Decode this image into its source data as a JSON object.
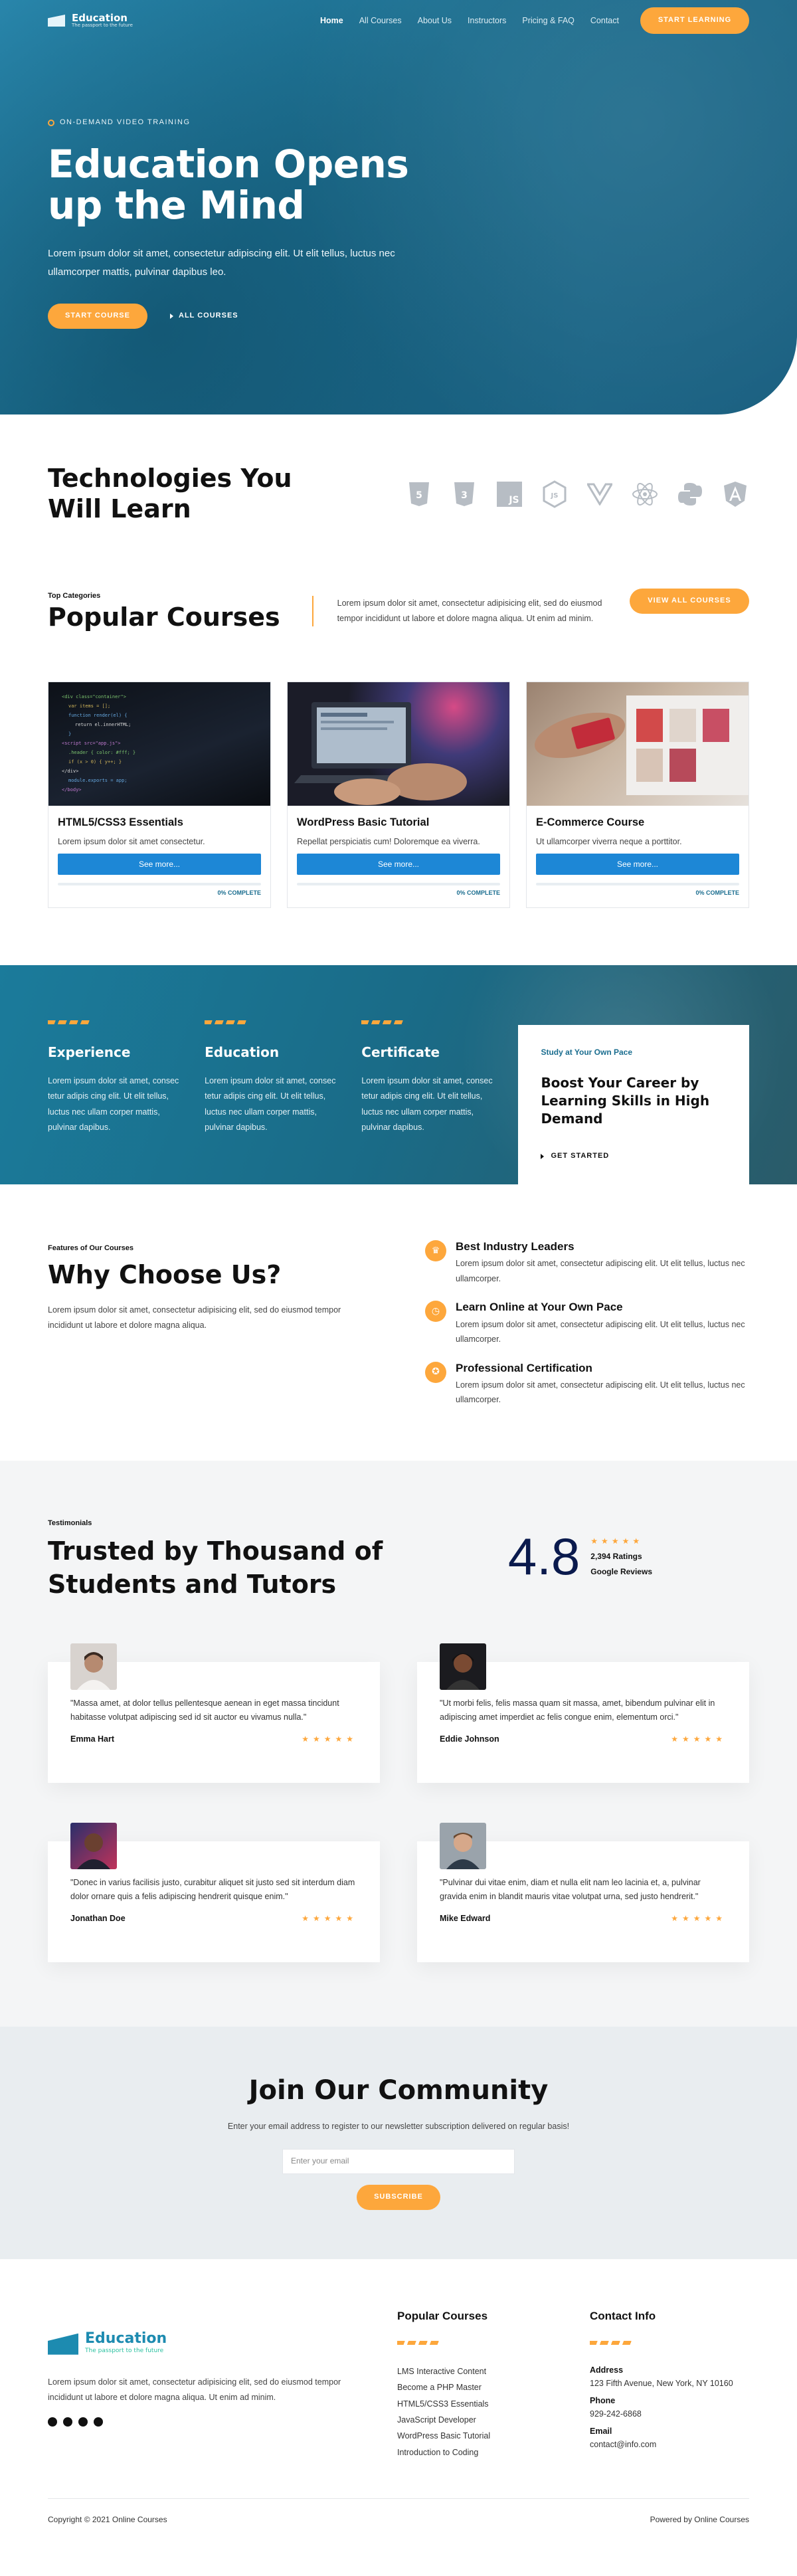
{
  "nav": {
    "logo_title": "Education",
    "logo_tagline": "The passport to the future",
    "items": [
      "Home",
      "All Courses",
      "About Us",
      "Instructors",
      "Pricing & FAQ",
      "Contact"
    ],
    "cta": "Start Learning"
  },
  "hero": {
    "eyebrow": "On-Demand Video Training",
    "title": "Education Opens up the Mind",
    "text": "Lorem ipsum dolor sit amet, consectetur adipiscing elit. Ut elit tellus, luctus nec ullamcorper mattis, pulvinar dapibus leo.",
    "cta_primary": "Start Course",
    "cta_secondary": "All Courses"
  },
  "tech": {
    "title": "Technologies You Will Learn",
    "icons": [
      "html5-icon",
      "css3-icon",
      "javascript-icon",
      "nodejs-icon",
      "vue-icon",
      "react-icon",
      "python-icon",
      "angular-icon"
    ]
  },
  "popular": {
    "eyebrow": "Top Categories",
    "title": "Popular Courses",
    "text": "Lorem ipsum dolor sit amet, consectetur adipisicing elit, sed do eiusmod tempor incididunt ut labore et dolore magna aliqua. Ut enim ad minim.",
    "cta": "View All Courses",
    "courses": [
      {
        "title": "HTML5/CSS3 Essentials",
        "text": "Lorem ipsum dolor sit amet consectetur.",
        "button": "See more...",
        "progress": "0% COMPLETE"
      },
      {
        "title": "WordPress Basic Tutorial",
        "text": "Repellat perspiciatis cum! Doloremque ea viverra.",
        "button": "See more...",
        "progress": "0% COMPLETE"
      },
      {
        "title": "E-Commerce Course",
        "text": "Ut ullamcorper viverra neque a porttitor.",
        "button": "See more...",
        "progress": "0% COMPLETE"
      }
    ]
  },
  "features": {
    "items": [
      {
        "title": "Experience",
        "text": "Lorem ipsum dolor sit amet, consec tetur adipis cing elit. Ut elit tellus, luctus nec ullam corper mattis, pulvinar dapibus."
      },
      {
        "title": "Education",
        "text": "Lorem ipsum dolor sit amet, consec tetur adipis cing elit. Ut elit tellus, luctus nec ullam corper mattis, pulvinar dapibus."
      },
      {
        "title": "Certificate",
        "text": "Lorem ipsum dolor sit amet, consec tetur adipis cing elit. Ut elit tellus, luctus nec ullam corper mattis, pulvinar dapibus."
      }
    ],
    "boost": {
      "eyebrow": "Study at Your Own Pace",
      "title": "Boost Your Career by Learning Skills in High Demand",
      "cta": "Get Started"
    }
  },
  "why": {
    "eyebrow": "Features of Our Courses",
    "title": "Why Choose Us?",
    "text": "Lorem ipsum dolor sit amet, consectetur adipisicing elit, sed do eiusmod tempor incididunt ut labore et dolore magna aliqua.",
    "items": [
      {
        "title": "Best Industry Leaders",
        "text": "Lorem ipsum dolor sit amet, consectetur adipiscing elit. Ut elit tellus, luctus nec ullamcorper."
      },
      {
        "title": "Learn Online at Your Own Pace",
        "text": "Lorem ipsum dolor sit amet, consectetur adipiscing elit. Ut elit tellus, luctus nec ullamcorper."
      },
      {
        "title": "Professional Certification",
        "text": "Lorem ipsum dolor sit amet, consectetur adipiscing elit. Ut elit tellus, luctus nec ullamcorper."
      }
    ]
  },
  "testimonials": {
    "eyebrow": "Testimonials",
    "title": "Trusted by Thousand of Students and Tutors",
    "score": "4.8",
    "stars": "★★★★★",
    "ratings": "2,394 Ratings",
    "source": "Google Reviews",
    "items": [
      {
        "quote": "\"Massa amet, at dolor tellus pellentesque aenean in eget massa tincidunt habitasse volutpat adipiscing sed id sit auctor eu vivamus nulla.\"",
        "name": "Emma Hart",
        "stars": "★★★★★"
      },
      {
        "quote": "\"Ut morbi felis, felis massa quam sit massa, amet, bibendum pulvinar elit in adipiscing amet imperdiet ac felis congue enim, elementum orci.\"",
        "name": "Eddie Johnson",
        "stars": "★★★★★"
      },
      {
        "quote": "\"Donec in varius facilisis justo, curabitur aliquet sit justo sed sit interdum diam dolor ornare quis a felis adipiscing hendrerit quisque enim.\"",
        "name": "Jonathan Doe",
        "stars": "★★★★★"
      },
      {
        "quote": "\"Pulvinar dui vitae enim, diam et nulla elit nam leo lacinia et, a, pulvinar gravida enim in blandit mauris vitae volutpat urna, sed justo hendrerit.\"",
        "name": "Mike Edward",
        "stars": "★★★★★"
      }
    ]
  },
  "community": {
    "title": "Join Our Community",
    "text": "Enter your email address to register to our newsletter subscription delivered on regular basis!",
    "placeholder": "Enter your email",
    "cta": "Subscribe"
  },
  "footer": {
    "logo_title": "Education",
    "logo_tagline": "The passport to the future",
    "text": "Lorem ipsum dolor sit amet, consectetur adipisicing elit, sed do eiusmod tempor incididunt ut labore et dolore magna aliqua. Ut enim ad minim.",
    "courses_title": "Popular Courses",
    "courses": [
      "LMS Interactive Content",
      "Become a PHP Master",
      "HTML5/CSS3 Essentials",
      "JavaScript Developer",
      "WordPress Basic Tutorial",
      "Introduction to Coding"
    ],
    "contact_title": "Contact Info",
    "address_label": "Address",
    "address": "123 Fifth Avenue, New York, NY 10160",
    "phone_label": "Phone",
    "phone": "929-242-6868",
    "email_label": "Email",
    "email": "contact@info.com",
    "copyright": "Copyright © 2021 Online Courses",
    "powered": "Powered by Online Courses"
  },
  "colors": {
    "accent": "#fda73c",
    "primary": "#1a6d8f",
    "button_blue": "#1d87d6",
    "heading": "#111111"
  }
}
